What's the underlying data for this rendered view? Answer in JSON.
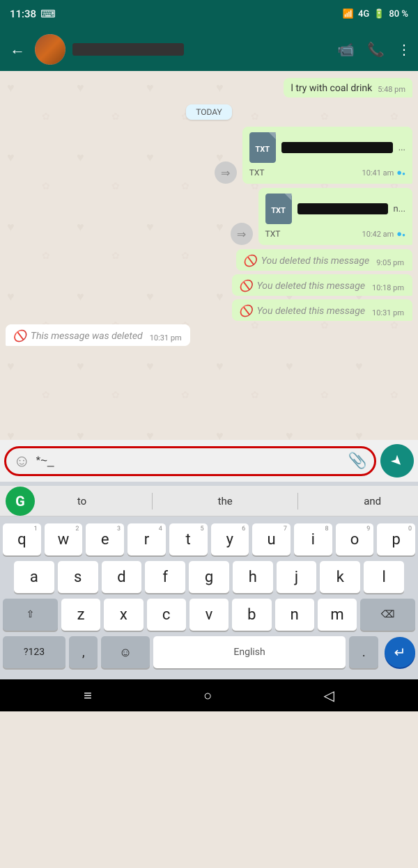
{
  "statusBar": {
    "time": "11:38",
    "signal": "4G",
    "battery": "80 %"
  },
  "header": {
    "backLabel": "←",
    "contactNamePlaceholder": "████████████████",
    "videoCallIcon": "📹",
    "phoneIcon": "📞",
    "moreIcon": "⋮"
  },
  "chat": {
    "prevMessage": {
      "text": "l try with coal drink",
      "time": "5:48 pm"
    },
    "todayLabel": "TODAY",
    "messages": [
      {
        "type": "forwarded-file",
        "fileType": "TXT",
        "time": "10:41 am",
        "read": true
      },
      {
        "type": "forwarded-file",
        "fileType": "TXT",
        "time": "10:42 am",
        "read": true
      },
      {
        "type": "deleted-sent",
        "text": "You deleted this message",
        "time": "9:05 pm"
      },
      {
        "type": "deleted-sent",
        "text": "You deleted this message",
        "time": "10:18 pm"
      },
      {
        "type": "deleted-sent",
        "text": "You deleted this message",
        "time": "10:31 pm"
      },
      {
        "type": "deleted-received",
        "text": "This message was deleted",
        "time": "10:31 pm"
      }
    ]
  },
  "inputBar": {
    "emojiIcon": "☺",
    "inputText": "*~_",
    "attachIcon": "📎",
    "sendIcon": "➤"
  },
  "keyboard": {
    "grammarly": "G",
    "suggestions": [
      "to",
      "the",
      "and"
    ],
    "rows": [
      [
        {
          "key": "q",
          "num": "1"
        },
        {
          "key": "w",
          "num": "2"
        },
        {
          "key": "e",
          "num": "3"
        },
        {
          "key": "r",
          "num": "4"
        },
        {
          "key": "t",
          "num": "5"
        },
        {
          "key": "y",
          "num": "6"
        },
        {
          "key": "u",
          "num": "7"
        },
        {
          "key": "i",
          "num": "8"
        },
        {
          "key": "o",
          "num": "9"
        },
        {
          "key": "p",
          "num": "0"
        }
      ],
      [
        {
          "key": "a"
        },
        {
          "key": "s"
        },
        {
          "key": "d"
        },
        {
          "key": "f"
        },
        {
          "key": "g"
        },
        {
          "key": "h"
        },
        {
          "key": "j"
        },
        {
          "key": "k"
        },
        {
          "key": "l"
        }
      ],
      [
        {
          "key": "z"
        },
        {
          "key": "x"
        },
        {
          "key": "c"
        },
        {
          "key": "v"
        },
        {
          "key": "b"
        },
        {
          "key": "n"
        },
        {
          "key": "m"
        }
      ]
    ],
    "bottomRow": {
      "numbers": "?123",
      "comma": ",",
      "emojiKey": "☺",
      "space": "English",
      "period": ".",
      "enter": "↵"
    }
  },
  "navBar": {
    "homeIcon": "≡",
    "circleIcon": "○",
    "backIcon": "◁"
  }
}
